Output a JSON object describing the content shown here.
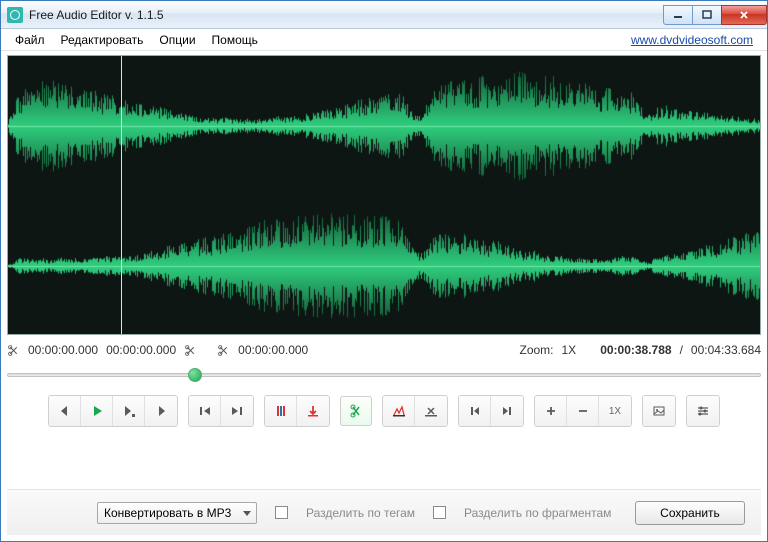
{
  "window": {
    "title": "Free Audio Editor v. 1.1.5"
  },
  "menu": {
    "file": "Файл",
    "edit": "Редактировать",
    "options": "Опции",
    "help": "Помощь",
    "link": "www.dvdvideosoft.com"
  },
  "time": {
    "sel_start": "00:00:00.000",
    "sel_end": "00:00:00.000",
    "cursor": "00:00:00.000",
    "zoom_label": "Zoom:",
    "zoom_value": "1X",
    "position": "00:00:38.788",
    "duration": "00:04:33.684",
    "slash": "/"
  },
  "toolbar": {
    "zoom_reset": "1X"
  },
  "bottom": {
    "convert": "Конвертировать в MP3",
    "split_tags": "Разделить по тегам",
    "split_fragments": "Разделить по фрагментам",
    "save": "Сохранить"
  }
}
